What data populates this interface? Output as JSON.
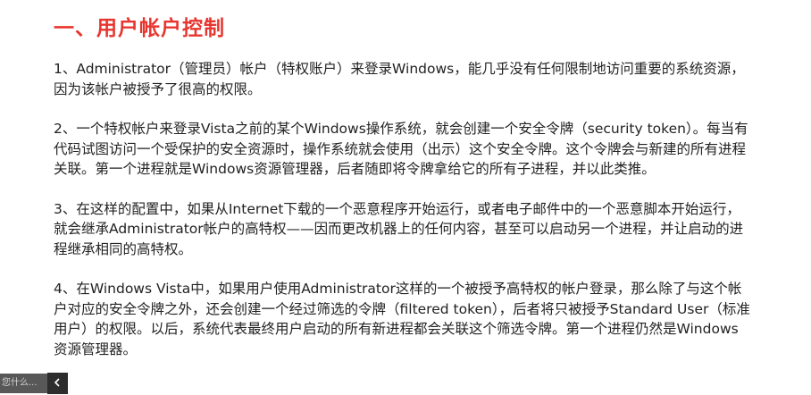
{
  "title": "一、用户帐户控制",
  "paragraphs": [
    "1、Administrator（管理员）帐户（特权账户）来登录Windows，能几乎没有任何限制地访问重要的系统资源，因为该帐户被授予了很高的权限。",
    "2、一个特权帐户来登录Vista之前的某个Windows操作系统，就会创建一个安全令牌（security token）。每当有代码试图访问一个受保护的安全资源时，操作系统就会使用（出示）这个安全令牌。这个令牌会与新建的所有进程关联。第一个进程就是Windows资源管理器，后者随即将令牌拿给它的所有子进程，并以此类推。",
    "3、在这样的配置中，如果从Internet下载的一个恶意程序开始运行，或者电子邮件中的一个恶意脚本开始运行，就会继承Administrator帐户的高特权——因而更改机器上的任何内容，甚至可以启动另一个进程，并让启动的进程继承相同的高特权。",
    "4、在Windows Vista中，如果用户使用Administrator这样的一个被授予高特权的帐户登录，那么除了与这个帐户对应的安全令牌之外，还会创建一个经过筛选的令牌（filtered token），后者将只被授予Standard User（标准用户）的权限。以后，系统代表最终用户启动的所有新进程都会关联这个筛选令牌。第一个进程仍然是Windows资源管理器。"
  ],
  "overlay": {
    "text": "您什么...",
    "button_icon": "chevron-left-icon"
  },
  "colors": {
    "title": "#e8352f",
    "body_text": "#222222",
    "overlay_bg": "#2d2d2d"
  }
}
